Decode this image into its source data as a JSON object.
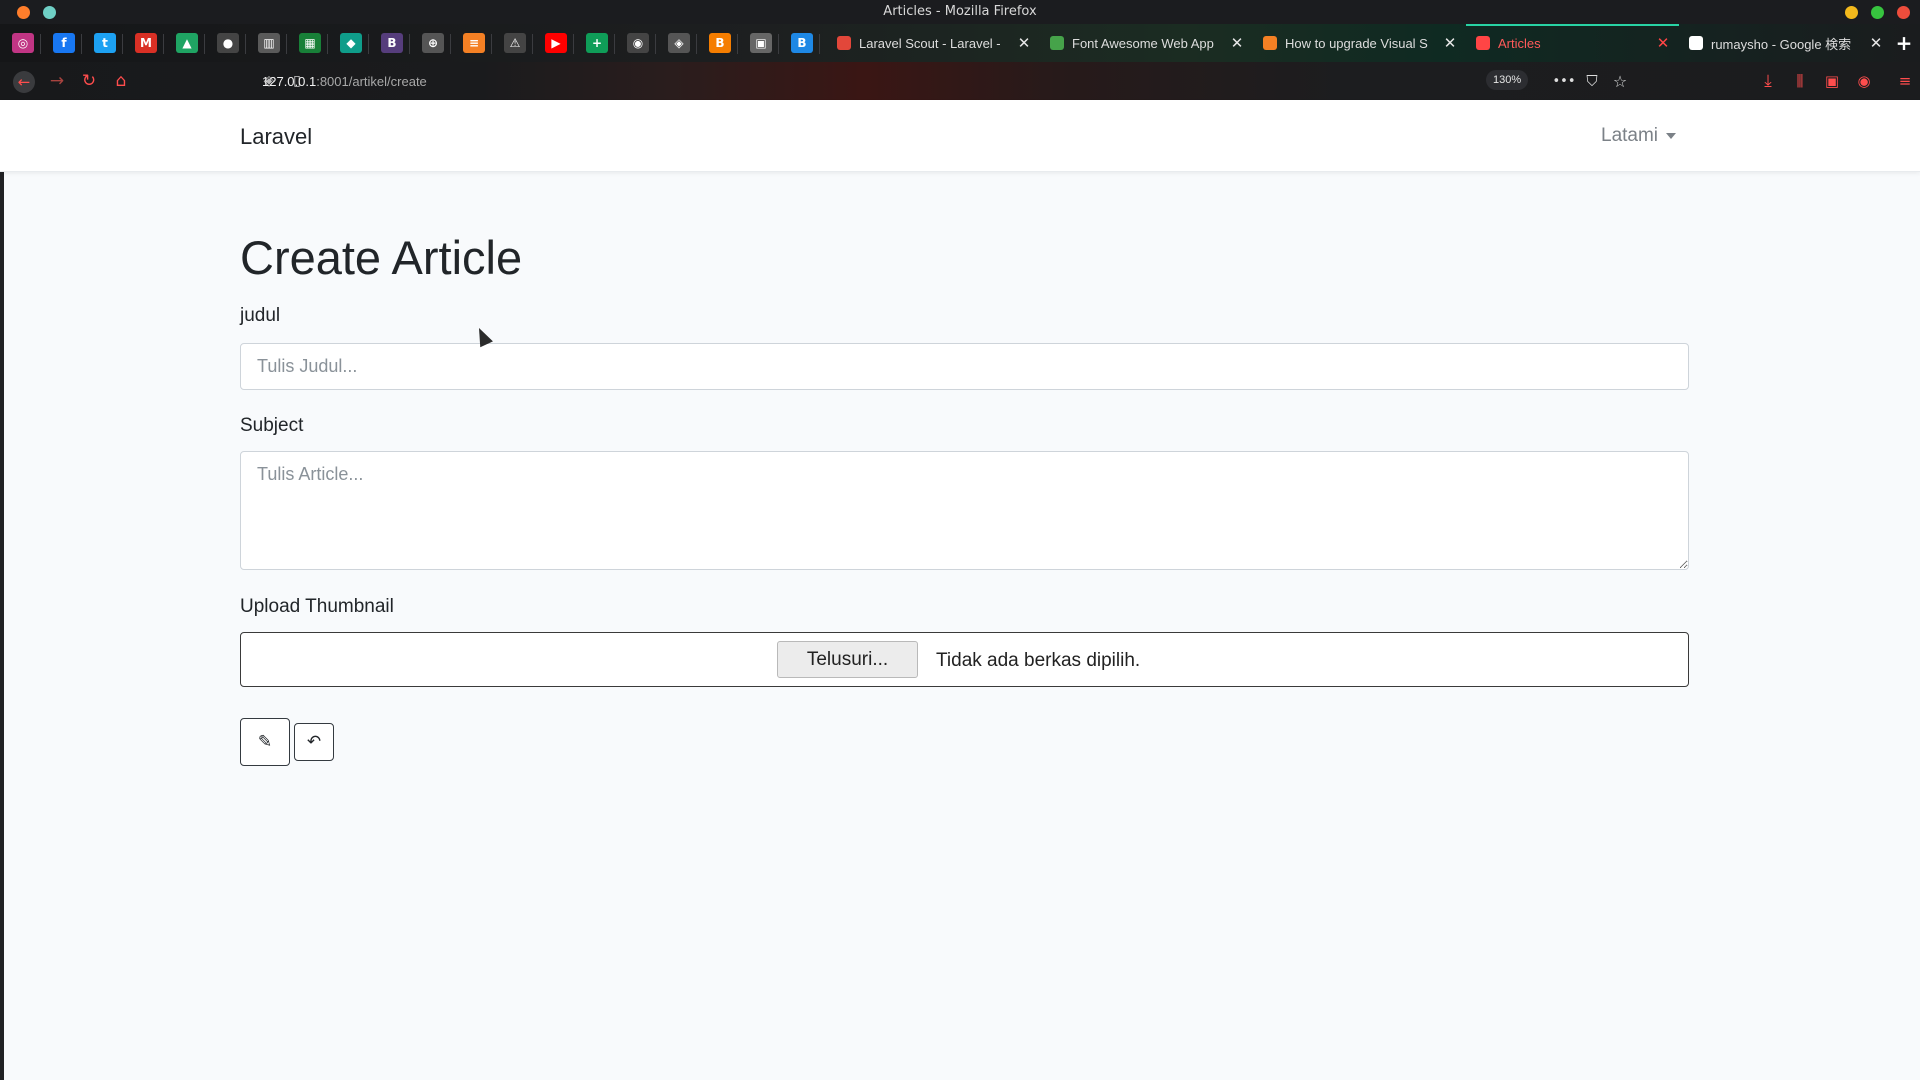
{
  "window": {
    "title": "Articles - Mozilla Firefox",
    "controls": [
      {
        "name": "minimize",
        "color": "#f3b91c"
      },
      {
        "name": "maximize",
        "color": "#37c43f"
      },
      {
        "name": "close",
        "color": "#ee4d3c"
      }
    ]
  },
  "pinned_tabs": [
    {
      "icon": "instagram-icon",
      "glyph": "◎",
      "color": "#c13584"
    },
    {
      "icon": "facebook-icon",
      "glyph": "f",
      "color": "#1877f2"
    },
    {
      "icon": "twitter-icon",
      "glyph": "t",
      "color": "#1da1f2"
    },
    {
      "icon": "gmail-icon",
      "glyph": "M",
      "color": "#d93025"
    },
    {
      "icon": "google-drive-icon",
      "glyph": "▲",
      "color": "#1fa463"
    },
    {
      "icon": "github-icon",
      "glyph": "●",
      "color": "#444"
    },
    {
      "icon": "trello-icon",
      "glyph": "▥",
      "color": "#5a5a5a"
    },
    {
      "icon": "sheets-icon",
      "glyph": "▦",
      "color": "#188038"
    },
    {
      "icon": "codepen-icon",
      "glyph": "◆",
      "color": "#0f9d8a"
    },
    {
      "icon": "bootstrap-icon",
      "glyph": "B",
      "color": "#563d7c"
    },
    {
      "icon": "globe-icon",
      "glyph": "⊕",
      "color": "#555"
    },
    {
      "icon": "stackoverflow-icon",
      "glyph": "≡",
      "color": "#f48024"
    },
    {
      "icon": "warning-icon",
      "glyph": "⚠",
      "color": "#444"
    },
    {
      "icon": "youtube-icon",
      "glyph": "▶",
      "color": "#ff0000"
    },
    {
      "icon": "plus-sheet-icon",
      "glyph": "+",
      "color": "#0f9d58"
    },
    {
      "icon": "circle-check-icon",
      "glyph": "◉",
      "color": "#444"
    },
    {
      "icon": "diamond-icon",
      "glyph": "◈",
      "color": "#555"
    },
    {
      "icon": "blogger-icon",
      "glyph": "B",
      "color": "#f57d00"
    },
    {
      "icon": "page-icon",
      "glyph": "▣",
      "color": "#666"
    },
    {
      "icon": "b-blue-icon",
      "glyph": "B",
      "color": "#1e88e5"
    }
  ],
  "tabs": [
    {
      "label": "Laravel Scout - Laravel -",
      "favicon_color": "#e2473a"
    },
    {
      "label": "Font Awesome Web App",
      "favicon_color": "#46a34a"
    },
    {
      "label": "How to upgrade Visual S",
      "favicon_color": "#f48024"
    },
    {
      "label": "Articles",
      "favicon_color": "#ff4545",
      "active": true
    },
    {
      "label": "rumaysho - Google 検索",
      "favicon_color": "#ffffff"
    }
  ],
  "new_tab": "+",
  "toolbar": {
    "url_host": "127.0.0.1",
    "url_path": ":8001/artikel/create",
    "zoom": "130%",
    "more": "•••"
  },
  "page": {
    "brand": "Laravel",
    "user": "Latami",
    "heading": "Create Article",
    "title_label": "judul",
    "title_placeholder": "Tulis Judul...",
    "subject_label": "Subject",
    "subject_placeholder": "Tulis Article...",
    "upload_label": "Upload Thumbnail",
    "browse_button": "Telusuri...",
    "file_status": "Tidak ada berkas dipilih.",
    "submit_icon": "✎",
    "back_icon": "↶"
  }
}
